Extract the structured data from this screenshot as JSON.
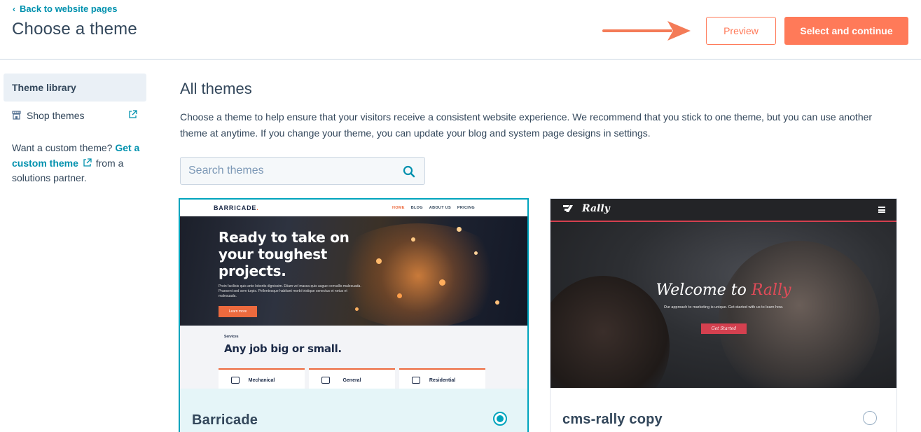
{
  "header": {
    "back_link": "Back to website pages",
    "title": "Choose a theme",
    "preview_label": "Preview",
    "select_label": "Select and continue"
  },
  "sidebar": {
    "active_item": "Theme library",
    "shop_item": "Shop themes",
    "custom_prefix": "Want a custom theme? ",
    "custom_link": "Get a custom theme",
    "custom_suffix": " from a solutions partner."
  },
  "main": {
    "section_title": "All themes",
    "description": "Choose a theme to help ensure that your visitors receive a consistent website experience. We recommend that you stick to one theme, but you can use another theme at anytime. If you change your theme, you can update your blog and system page designs in settings.",
    "search_placeholder": "Search themes"
  },
  "themes": [
    {
      "name": "Barricade",
      "selected": true,
      "preview": {
        "logo": "BARRICADE",
        "logo_dot": ".",
        "menu": [
          "HOME",
          "BLOG",
          "ABOUT US",
          "PRICING"
        ],
        "headline_1": "Ready to take on",
        "headline_2": "your toughest",
        "headline_3": "projects.",
        "paragraph": "Proin facilisis quis ante lobortis dignissim. Etiam vel massa quis augue convallis malesuada. Praesent sed sem turpis. Pellentesque habitant morbi tristique senectus et netus et malesuada.",
        "button": "Learn more",
        "services_label": "Services",
        "services_title": "Any job big or small.",
        "boxes": [
          "Mechanical",
          "General",
          "Residential"
        ]
      }
    },
    {
      "name": "cms-rally copy",
      "selected": false,
      "preview": {
        "logo": "Rally",
        "welcome_prefix": "Welcome to ",
        "welcome_brand": "Rally",
        "subtitle": "Our approach to marketing is unique. Get started with us to learn how.",
        "button": "Get Started"
      }
    }
  ],
  "colors": {
    "accent": "#ff7a59",
    "link": "#0091ae",
    "selected": "#00a4bd",
    "text": "#33475b"
  }
}
